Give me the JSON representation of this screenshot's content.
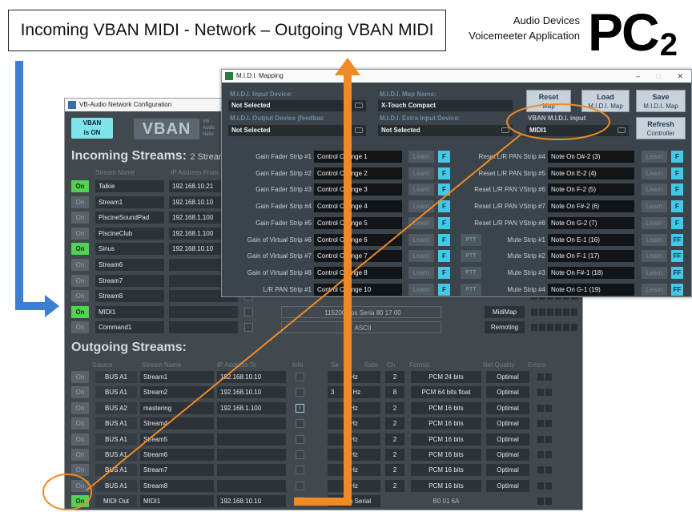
{
  "slide": {
    "title": "Incoming VBAN MIDI - Network – Outgoing VBAN MIDI",
    "brand_line1": "Audio Devices",
    "brand_line2": "Voicemeeter Application",
    "brand_logo": "PC",
    "brand_logo_sub": "2"
  },
  "network_window": {
    "title": "VB-Audio Network Configuration",
    "vban_button": "VBAN\nis ON",
    "logo": "VBAN",
    "logo_sub": "VB\nAudio\nNetw",
    "incoming": {
      "heading": "Incoming Streams:",
      "subheading": "2 Streams De",
      "col_stream": "Stream Name",
      "col_ip": "IP Address From",
      "rows": [
        {
          "on": "On",
          "active": true,
          "name": "Talkie",
          "ip": "192.168.10.21",
          "extra": "",
          "btn": ""
        },
        {
          "on": "On",
          "active": false,
          "name": "Stream1",
          "ip": "192.168.10.10",
          "extra": "",
          "btn": ""
        },
        {
          "on": "On",
          "active": false,
          "name": "PiscineSoundPad",
          "ip": "192.168.1.100",
          "extra": "",
          "btn": ""
        },
        {
          "on": "On",
          "active": false,
          "name": "PiscineClub",
          "ip": "192.168.1.100",
          "extra": "",
          "btn": ""
        },
        {
          "on": "On",
          "active": true,
          "name": "Sinus",
          "ip": "192.168.10.10",
          "extra": "",
          "btn": ""
        },
        {
          "on": "On",
          "active": false,
          "name": "Stream6",
          "ip": "",
          "extra": "",
          "btn": ""
        },
        {
          "on": "On",
          "active": false,
          "name": "Stream7",
          "ip": "",
          "extra": "",
          "btn": ""
        },
        {
          "on": "On",
          "active": false,
          "name": "Stream8",
          "ip": "",
          "extra": "",
          "btn": ""
        },
        {
          "on": "On",
          "active": true,
          "name": "MIDI1",
          "ip": "",
          "extra": "115200 bps Seria    80 17 00",
          "btn": "MidiMap"
        },
        {
          "on": "On",
          "active": false,
          "name": "Command1",
          "ip": "",
          "extra": "ASCII",
          "btn": "Remoting"
        }
      ]
    },
    "outgoing": {
      "heading": "Outgoing Streams:",
      "columns": [
        "Source",
        "Stream Name",
        "IP Address To",
        "Info",
        "Sa",
        "Rate",
        "Ch",
        "Format",
        "Net Quality",
        "Errors"
      ],
      "rows": [
        {
          "on": "On",
          "active": false,
          "source": "BUS A1",
          "name": "Stream1",
          "ip": "192.168.10.10",
          "info": false,
          "rate": "Hz",
          "rate_prefix": "",
          "ch": "2",
          "format": "PCM 24 bits",
          "quality": "Optimal"
        },
        {
          "on": "On",
          "active": false,
          "source": "BUS A1",
          "name": "Stream2",
          "ip": "192.168.10.10",
          "info": false,
          "rate": "0 Hz",
          "rate_prefix": "3",
          "ch": "8",
          "format": "PCM 64 bits float",
          "quality": "Optimal"
        },
        {
          "on": "On",
          "active": false,
          "source": "BUS A2",
          "name": "mastering",
          "ip": "192.168.1.100",
          "info": true,
          "rate": "Hz",
          "rate_prefix": "",
          "ch": "2",
          "format": "PCM 16 bits",
          "quality": "Optimal"
        },
        {
          "on": "On",
          "active": false,
          "source": "BUS A1",
          "name": "Stream4",
          "ip": "",
          "info": false,
          "rate": "Hz",
          "rate_prefix": "",
          "ch": "2",
          "format": "PCM 16 bits",
          "quality": "Optimal"
        },
        {
          "on": "On",
          "active": false,
          "source": "BUS A1",
          "name": "Stream5",
          "ip": "",
          "info": false,
          "rate": "Hz",
          "rate_prefix": "",
          "ch": "2",
          "format": "PCM 16 bits",
          "quality": "Optimal"
        },
        {
          "on": "On",
          "active": false,
          "source": "BUS A1",
          "name": "Stream6",
          "ip": "",
          "info": false,
          "rate": "Hz",
          "rate_prefix": "",
          "ch": "2",
          "format": "PCM 16 bits",
          "quality": "Optimal"
        },
        {
          "on": "On",
          "active": false,
          "source": "BUS A1",
          "name": "Stream7",
          "ip": "",
          "info": false,
          "rate": "Hz",
          "rate_prefix": "",
          "ch": "2",
          "format": "PCM 16 bits",
          "quality": "Optimal"
        },
        {
          "on": "On",
          "active": false,
          "source": "BUS A1",
          "name": "Stream8",
          "ip": "",
          "info": false,
          "rate": "Hz",
          "rate_prefix": "",
          "ch": "2",
          "format": "PCM 16 bits",
          "quality": "Optimal"
        },
        {
          "on": "On",
          "active": true,
          "source": "MIDI Out",
          "name": "MIDI1",
          "ip": "192.168.10.10",
          "info": false,
          "rate": "0 bps Serial",
          "rate_prefix": "",
          "ch": "",
          "format": "B0 01 6A",
          "quality": ""
        }
      ]
    }
  },
  "midi_window": {
    "title": "M.I.D.I. Mapping",
    "controls": {
      "min": "–",
      "max": "□",
      "close": "✕"
    },
    "input_device_label": "M.I.D.I. Input Device:",
    "input_device_value": "Not Selected",
    "output_device_label": "M.I.D.I. Output Device (feedbac",
    "output_device_value": "Not Selected",
    "map_name_label": "M.I.D.I. Map Name:",
    "map_name_value": "X-Touch Compact",
    "extra_input_label": "M.I.D.I. Extra Input Device:",
    "extra_input_value": "Not Selected",
    "vban_input_label": "VBAN M.I.D.I. input",
    "vban_input_value": "MIDI1",
    "reset_button": {
      "line1": "Reset",
      "line2": "Map"
    },
    "load_button": {
      "line1": "Load",
      "line2": "M.I.D.I. Map"
    },
    "save_button": {
      "line1": "Save",
      "line2": "M.I.D.I. Map"
    },
    "refresh_button": {
      "line1": "Refresh",
      "line2": "Controller"
    },
    "learn_label": "Learn",
    "ptt_label": "PTT",
    "left_rows": [
      {
        "label": "Gain Fader Strip #1",
        "value": "Control Change 1",
        "f": "F",
        "ptt": false
      },
      {
        "label": "Gain Fader Strip #2",
        "value": "Control Change 2",
        "f": "F",
        "ptt": false
      },
      {
        "label": "Gain Fader Strip #3",
        "value": "Control Change 3",
        "f": "F",
        "ptt": false
      },
      {
        "label": "Gain Fader Strip #4",
        "value": "Control Change 4",
        "f": "F",
        "ptt": false
      },
      {
        "label": "Gain Fader Strip #5",
        "value": "Control Change 5",
        "f": "F",
        "ptt": false
      },
      {
        "label": "Gain of Virtual Strip #6",
        "value": "Control Change 6",
        "f": "F",
        "ptt": true
      },
      {
        "label": "Gain of Virtual Strip #7",
        "value": "Control Change 7",
        "f": "F",
        "ptt": true
      },
      {
        "label": "Gain of Virtual Strip #8",
        "value": "Control Change 8",
        "f": "F",
        "ptt": true
      },
      {
        "label": "L/R PAN Strip #1",
        "value": "Control Change 10",
        "f": "F",
        "ptt": true
      }
    ],
    "right_rows": [
      {
        "label": "Reset L/R PAN Strip #4",
        "value": "Note On D#-2 (3)",
        "f": "F"
      },
      {
        "label": "Reset L/R PAN Strip #5",
        "value": "Note On E-2 (4)",
        "f": "F"
      },
      {
        "label": "Reset L/R PAN VStrip #6",
        "value": "Note On F-2 (5)",
        "f": "F"
      },
      {
        "label": "Reset L/R PAN VStrip #7",
        "value": "Note On F#-2 (6)",
        "f": "F"
      },
      {
        "label": "Reset L/R PAN VStrip #8",
        "value": "Note On G-2 (7)",
        "f": "F"
      },
      {
        "label": "Mute Strip #1",
        "value": "Note On E-1 (16)",
        "f": "FF"
      },
      {
        "label": "Mute Strip #2",
        "value": "Note On F-1 (17)",
        "f": "FF"
      },
      {
        "label": "Mute Strip #3",
        "value": "Note On F#-1 (18)",
        "f": "FF"
      },
      {
        "label": "Mute Strip #4",
        "value": "Note On G-1 (19)",
        "f": "FF"
      }
    ]
  },
  "colors": {
    "arrow_orange": "#f08a24",
    "arrow_blue": "#3b7fd0",
    "active_green": "#53d152",
    "accent_cyan": "#43c8e8"
  }
}
